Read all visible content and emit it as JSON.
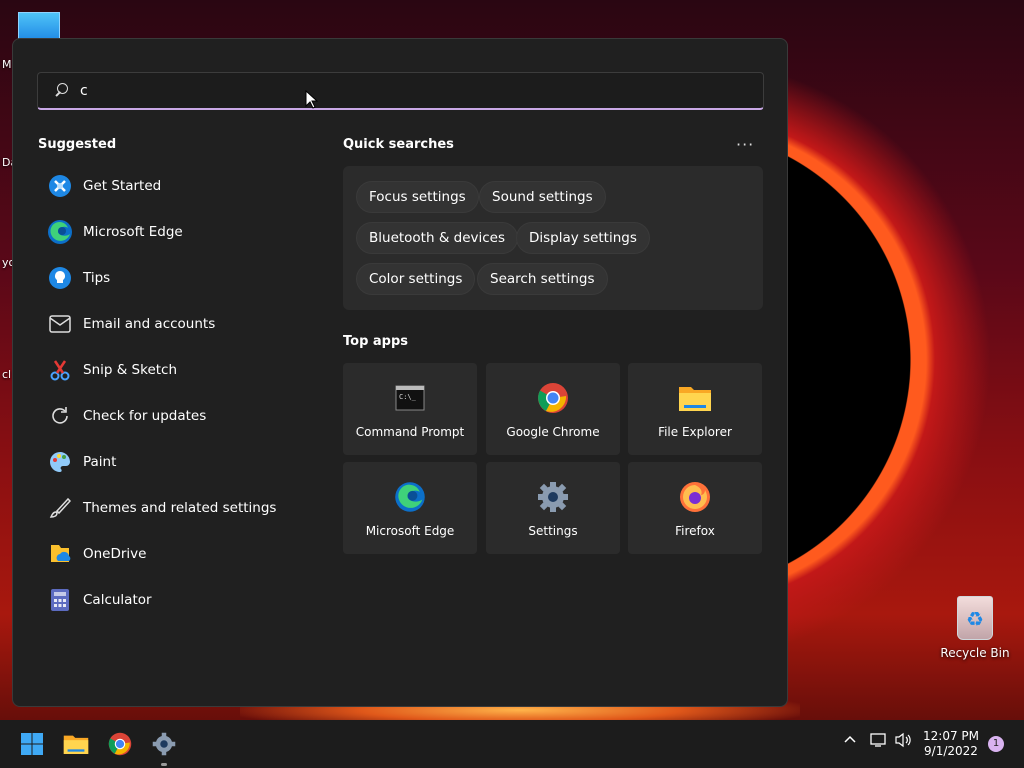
{
  "desktop": {
    "edge_labels": [
      "M",
      "Da",
      "yo",
      "cl"
    ],
    "recycle_bin_label": "Recycle Bin"
  },
  "search": {
    "value": "c",
    "placeholder": ""
  },
  "suggested": {
    "title": "Suggested",
    "items": [
      {
        "label": "Get Started",
        "icon": "get-started-icon"
      },
      {
        "label": "Microsoft Edge",
        "icon": "edge-icon"
      },
      {
        "label": "Tips",
        "icon": "lightbulb-icon"
      },
      {
        "label": "Email and accounts",
        "icon": "mail-icon"
      },
      {
        "label": "Snip & Sketch",
        "icon": "snip-sketch-icon"
      },
      {
        "label": "Check for updates",
        "icon": "refresh-icon"
      },
      {
        "label": "Paint",
        "icon": "paint-icon"
      },
      {
        "label": "Themes and related settings",
        "icon": "brush-icon"
      },
      {
        "label": "OneDrive",
        "icon": "onedrive-icon"
      },
      {
        "label": "Calculator",
        "icon": "calculator-icon"
      }
    ]
  },
  "quick_searches": {
    "title": "Quick searches",
    "more": "···",
    "chips": [
      "Focus settings",
      "Sound settings",
      "Bluetooth & devices",
      "Display settings",
      "Color settings",
      "Search settings"
    ]
  },
  "top_apps": {
    "title": "Top apps",
    "apps": [
      {
        "label": "Command Prompt",
        "icon": "command-prompt-icon"
      },
      {
        "label": "Google Chrome",
        "icon": "chrome-icon"
      },
      {
        "label": "File Explorer",
        "icon": "file-explorer-icon"
      },
      {
        "label": "Microsoft Edge",
        "icon": "edge-icon"
      },
      {
        "label": "Settings",
        "icon": "settings-gear-icon"
      },
      {
        "label": "Firefox",
        "icon": "firefox-icon"
      }
    ]
  },
  "taskbar": {
    "time": "12:07 PM",
    "date": "9/1/2022",
    "notification_count": "1"
  }
}
